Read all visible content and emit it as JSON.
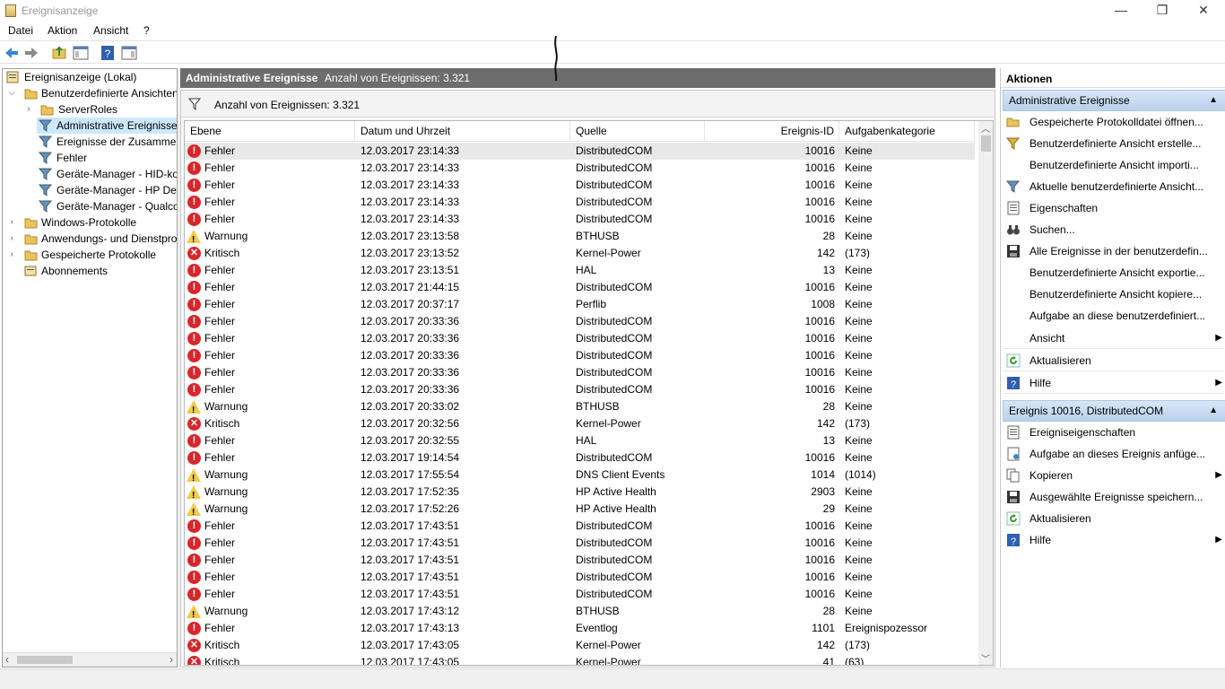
{
  "window": {
    "title": "Ereignisanzeige",
    "min": "—",
    "restore": "❐",
    "close": "✕"
  },
  "menu": [
    "Datei",
    "Aktion",
    "Ansicht",
    "?"
  ],
  "tree": [
    {
      "label": "Ereignisanzeige (Lokal)"
    },
    {
      "label": "Benutzerdefinierte Ansichten"
    },
    {
      "label": "ServerRoles"
    },
    {
      "label": "Administrative Ereignisse"
    },
    {
      "label": "Ereignisse der Zusammenfassungsseite"
    },
    {
      "label": "Fehler"
    },
    {
      "label": "Geräte-Manager - HID-konforme Maus"
    },
    {
      "label": "Geräte-Manager - HP Device"
    },
    {
      "label": "Geräte-Manager - Qualcomm"
    },
    {
      "label": "Windows-Protokolle"
    },
    {
      "label": "Anwendungs- und Dienstprotokolle"
    },
    {
      "label": "Gespeicherte Protokolle"
    },
    {
      "label": "Abonnements"
    }
  ],
  "center": {
    "title": "Administrative Ereignisse",
    "count": "Anzahl von Ereignissen: 3.321",
    "filter": "Anzahl von Ereignissen: 3.321"
  },
  "columns": [
    "Ebene",
    "Datum und Uhrzeit",
    "Quelle",
    "Ereignis-ID",
    "Aufgabenkategorie"
  ],
  "rows": [
    [
      "Fehler",
      "12.03.2017 23:14:33",
      "DistributedCOM",
      "10016",
      "Keine"
    ],
    [
      "Fehler",
      "12.03.2017 23:14:33",
      "DistributedCOM",
      "10016",
      "Keine"
    ],
    [
      "Fehler",
      "12.03.2017 23:14:33",
      "DistributedCOM",
      "10016",
      "Keine"
    ],
    [
      "Fehler",
      "12.03.2017 23:14:33",
      "DistributedCOM",
      "10016",
      "Keine"
    ],
    [
      "Fehler",
      "12.03.2017 23:14:33",
      "DistributedCOM",
      "10016",
      "Keine"
    ],
    [
      "Warnung",
      "12.03.2017 23:13:58",
      "BTHUSB",
      "28",
      "Keine"
    ],
    [
      "Kritisch",
      "12.03.2017 23:13:52",
      "Kernel-Power",
      "142",
      "(173)"
    ],
    [
      "Fehler",
      "12.03.2017 23:13:51",
      "HAL",
      "13",
      "Keine"
    ],
    [
      "Fehler",
      "12.03.2017 21:44:15",
      "DistributedCOM",
      "10016",
      "Keine"
    ],
    [
      "Fehler",
      "12.03.2017 20:37:17",
      "Perflib",
      "1008",
      "Keine"
    ],
    [
      "Fehler",
      "12.03.2017 20:33:36",
      "DistributedCOM",
      "10016",
      "Keine"
    ],
    [
      "Fehler",
      "12.03.2017 20:33:36",
      "DistributedCOM",
      "10016",
      "Keine"
    ],
    [
      "Fehler",
      "12.03.2017 20:33:36",
      "DistributedCOM",
      "10016",
      "Keine"
    ],
    [
      "Fehler",
      "12.03.2017 20:33:36",
      "DistributedCOM",
      "10016",
      "Keine"
    ],
    [
      "Fehler",
      "12.03.2017 20:33:36",
      "DistributedCOM",
      "10016",
      "Keine"
    ],
    [
      "Warnung",
      "12.03.2017 20:33:02",
      "BTHUSB",
      "28",
      "Keine"
    ],
    [
      "Kritisch",
      "12.03.2017 20:32:56",
      "Kernel-Power",
      "142",
      "(173)"
    ],
    [
      "Fehler",
      "12.03.2017 20:32:55",
      "HAL",
      "13",
      "Keine"
    ],
    [
      "Fehler",
      "12.03.2017 19:14:54",
      "DistributedCOM",
      "10016",
      "Keine"
    ],
    [
      "Warnung",
      "12.03.2017 17:55:54",
      "DNS Client Events",
      "1014",
      "(1014)"
    ],
    [
      "Warnung",
      "12.03.2017 17:52:35",
      "HP Active Health",
      "2903",
      "Keine"
    ],
    [
      "Warnung",
      "12.03.2017 17:52:26",
      "HP Active Health",
      "29",
      "Keine"
    ],
    [
      "Fehler",
      "12.03.2017 17:43:51",
      "DistributedCOM",
      "10016",
      "Keine"
    ],
    [
      "Fehler",
      "12.03.2017 17:43:51",
      "DistributedCOM",
      "10016",
      "Keine"
    ],
    [
      "Fehler",
      "12.03.2017 17:43:51",
      "DistributedCOM",
      "10016",
      "Keine"
    ],
    [
      "Fehler",
      "12.03.2017 17:43:51",
      "DistributedCOM",
      "10016",
      "Keine"
    ],
    [
      "Fehler",
      "12.03.2017 17:43:51",
      "DistributedCOM",
      "10016",
      "Keine"
    ],
    [
      "Warnung",
      "12.03.2017 17:43:12",
      "BTHUSB",
      "28",
      "Keine"
    ],
    [
      "Fehler",
      "12.03.2017 17:43:13",
      "Eventlog",
      "1101",
      "Ereignispozessor"
    ],
    [
      "Kritisch",
      "12.03.2017 17:43:05",
      "Kernel-Power",
      "142",
      "(173)"
    ],
    [
      "Kritisch",
      "12.03.2017 17:43:05",
      "Kernel-Power",
      "41",
      "(63)"
    ]
  ],
  "actions": {
    "header": "Aktionen",
    "section1": "Administrative Ereignisse",
    "items1": [
      {
        "label": "Gespeicherte Protokolldatei öffnen...",
        "icon": "folder-open-icon"
      },
      {
        "label": "Benutzerdefinierte Ansicht erstelle...",
        "icon": "filter-add-icon"
      },
      {
        "label": "Benutzerdefinierte Ansicht importi...",
        "icon": ""
      },
      {
        "label": "Aktuelle benutzerdefinierte Ansicht...",
        "icon": "filter-icon"
      },
      {
        "label": "Eigenschaften",
        "icon": "properties-icon"
      },
      {
        "label": "Suchen...",
        "icon": "binoculars-icon"
      },
      {
        "label": "Alle Ereignisse in der benutzerdefin...",
        "icon": "save-icon"
      },
      {
        "label": "Benutzerdefinierte Ansicht exportie...",
        "icon": ""
      },
      {
        "label": "Benutzerdefinierte Ansicht kopiere...",
        "icon": ""
      },
      {
        "label": "Aufgabe an diese benutzerdefiniert...",
        "icon": ""
      },
      {
        "label": "Ansicht",
        "icon": "",
        "submenu": true
      },
      {
        "label": "Aktualisieren",
        "icon": "refresh-icon"
      },
      {
        "label": "Hilfe",
        "icon": "help-icon",
        "submenu": true
      }
    ],
    "section2": "Ereignis 10016, DistributedCOM",
    "items2": [
      {
        "label": "Ereigniseigenschaften",
        "icon": "properties-icon"
      },
      {
        "label": "Aufgabe an dieses Ereignis anfüge...",
        "icon": "task-icon"
      },
      {
        "label": "Kopieren",
        "icon": "copy-icon",
        "submenu": true
      },
      {
        "label": "Ausgewählte Ereignisse speichern...",
        "icon": "save-icon"
      },
      {
        "label": "Aktualisieren",
        "icon": "refresh-icon"
      },
      {
        "label": "Hilfe",
        "icon": "help-icon",
        "submenu": true
      }
    ]
  }
}
